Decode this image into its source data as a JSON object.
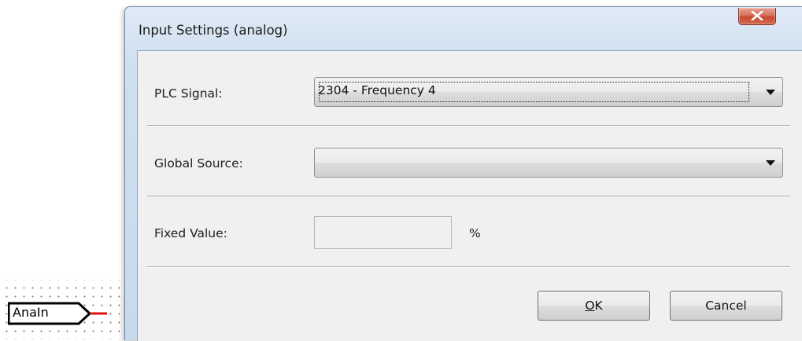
{
  "canvas": {
    "block_label": "AnaIn"
  },
  "dialog": {
    "title": "Input Settings (analog)",
    "plc_signal": {
      "label": "PLC Signal:",
      "value": "2304 - Frequency 4"
    },
    "global_source": {
      "label": "Global Source:",
      "value": ""
    },
    "fixed_value": {
      "label": "Fixed Value:",
      "value": "",
      "unit": "%"
    },
    "buttons": {
      "ok_mnemonic": "O",
      "ok_rest": "K",
      "cancel": "Cancel"
    }
  },
  "colors": {
    "accent_close": "#c64a33",
    "connector_red": "#e01010"
  },
  "icons": {
    "close": "close-icon",
    "dropdown": "chevron-down-icon"
  }
}
